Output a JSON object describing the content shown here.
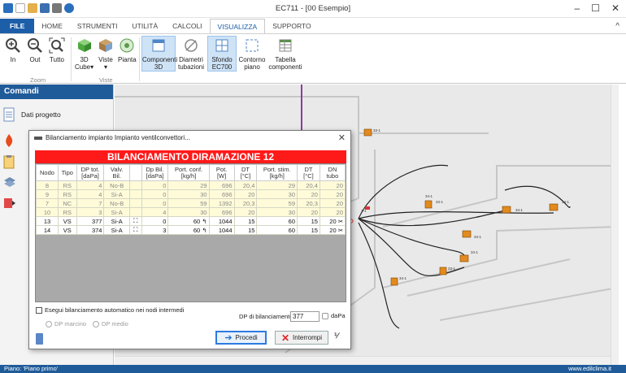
{
  "window": {
    "title": "EC711 - [00 Esempio]"
  },
  "ribbon_tabs": [
    "FILE",
    "HOME",
    "STRUMENTI",
    "UTILITÀ",
    "CALCOLI",
    "VISUALIZZA",
    "SUPPORTO"
  ],
  "ribbon": {
    "zoom": {
      "in": "In",
      "out": "Out",
      "tutto": "Tutto",
      "group": "Zoom"
    },
    "viste": {
      "cube": "3D",
      "cube2": "Cube",
      "viste": "Viste",
      "pianta": "Pianta",
      "group": "Viste"
    },
    "display": {
      "componenti": "Componenti",
      "componenti2": "3D",
      "diametri": "Diametri",
      "diametri2": "tubazioni",
      "sfondo": "Sfondo",
      "sfondo2": "EC700",
      "contorno": "Contorno",
      "contorno2": "piano",
      "tabella": "Tabella",
      "tabella2": "componenti"
    }
  },
  "sidebar": {
    "header": "Comandi",
    "dati_progetto": "Dati progetto"
  },
  "dialog": {
    "title": "Bilanciamento impianto Impianto ventilconvettori...",
    "banner": "BILANCIAMENTO DIRAMAZIONE 12",
    "columns": [
      "Nodo",
      "Tipo",
      "DP tot.\n[daPa]",
      "Valv.\nBil.",
      "",
      "Dp Bil.\n[daPa]",
      "Port. conf.\n[kg/h]",
      "Pot.\n[W]",
      "DT\n[°C]",
      "Port. stim.\n[kg/h]",
      "DT\n[°C]",
      "DN\ntubo"
    ],
    "rows": [
      {
        "nodo": "8",
        "tipo": "RS",
        "dp": "4",
        "valv": "No-B",
        "dpbil": "0",
        "pconf": "29",
        "pot": "696",
        "dt": "20,4",
        "pstim": "29",
        "dt2": "20,4",
        "dn": "20",
        "active": false
      },
      {
        "nodo": "9",
        "tipo": "RS",
        "dp": "4",
        "valv": "Si-A",
        "dpbil": "0",
        "pconf": "30",
        "pot": "696",
        "dt": "20",
        "pstim": "30",
        "dt2": "20",
        "dn": "20",
        "active": false
      },
      {
        "nodo": "7",
        "tipo": "NC",
        "dp": "7",
        "valv": "No-B",
        "dpbil": "0",
        "pconf": "59",
        "pot": "1392",
        "dt": "20,3",
        "pstim": "59",
        "dt2": "20,3",
        "dn": "20",
        "active": false
      },
      {
        "nodo": "10",
        "tipo": "RS",
        "dp": "3",
        "valv": "Si-A",
        "dpbil": "4",
        "pconf": "30",
        "pot": "696",
        "dt": "20",
        "pstim": "30",
        "dt2": "20",
        "dn": "20",
        "active": false
      },
      {
        "nodo": "13",
        "tipo": "VS",
        "dp": "377",
        "valv": "Si-A",
        "dpbil": "0",
        "pconf": "60",
        "pot": "1044",
        "dt": "15",
        "pstim": "60",
        "dt2": "15",
        "dn": "20",
        "active": true
      },
      {
        "nodo": "14",
        "tipo": "VS",
        "dp": "374",
        "valv": "Si-A",
        "dpbil": "3",
        "pconf": "60",
        "pot": "1044",
        "dt": "15",
        "pstim": "60",
        "dt2": "15",
        "dn": "20",
        "active": true
      }
    ],
    "auto_balance_label": "Esegui bilanciamento automatico nei nodi intermedi",
    "dp_marcino": "DP marcino",
    "dp_medio": "DP medio",
    "dp_bil_label": "DP di bilanciamento:",
    "dp_bil_value": "377",
    "dp_unit": "daPa",
    "procedi": "Procedi",
    "interrompi": "Interrompi"
  },
  "canvas_labels": [
    "1-1",
    "33-1",
    "34-1",
    "34-1",
    "34-1",
    "34-1",
    "34-1",
    "33-1",
    "34-1",
    "34-1"
  ],
  "status": {
    "left": "Piano: 'Piano primo'",
    "right": "www.edilclima.it"
  }
}
